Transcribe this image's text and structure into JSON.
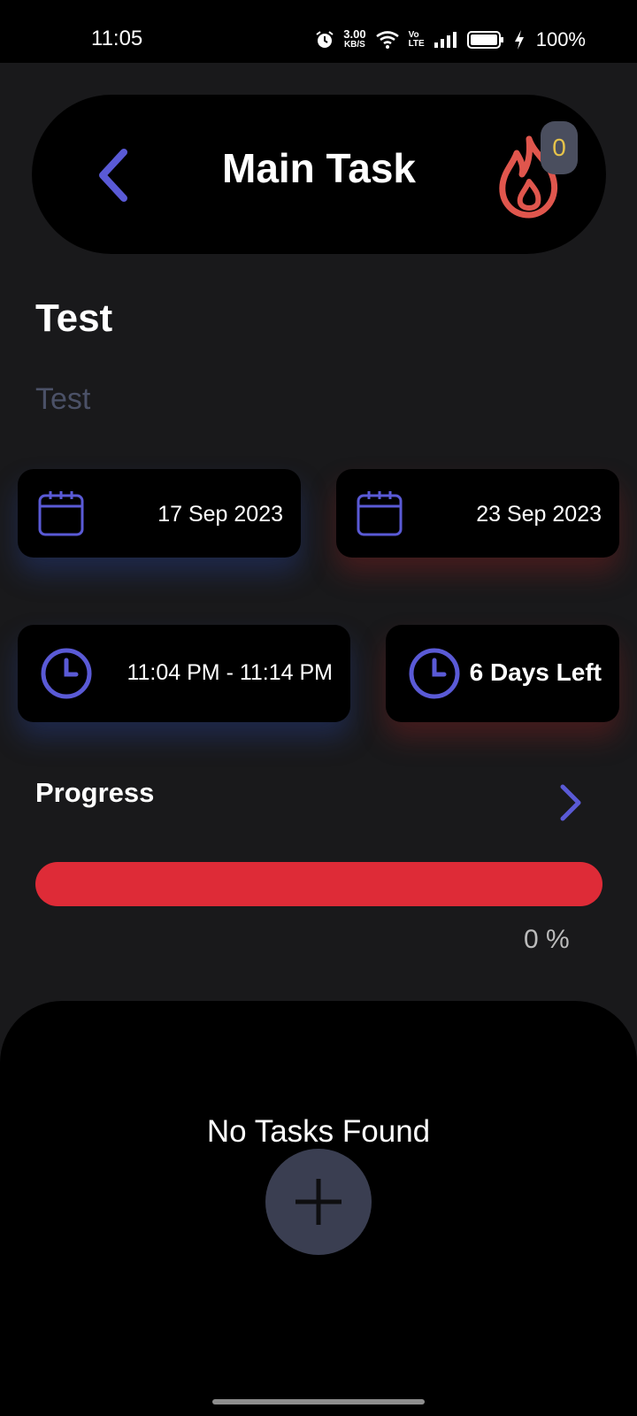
{
  "status_bar": {
    "time": "11:05",
    "net_speed": "3.00",
    "net_speed_unit": "KB/S",
    "volte_top": "Vo",
    "volte_bottom": "LTE",
    "battery": "100%"
  },
  "header": {
    "title": "Main Task",
    "streak_count": "0",
    "icons": [
      "back-arrow-icon",
      "fire-icon"
    ]
  },
  "task": {
    "title": "Test",
    "description": "Test"
  },
  "dates": {
    "start": "17 Sep 2023",
    "end": "23 Sep 2023"
  },
  "time": {
    "range": "11:04 PM - 11:14 PM",
    "days_left": "6 Days Left"
  },
  "progress": {
    "label": "Progress",
    "value": 0,
    "percent_text": "0 %"
  },
  "subtasks": {
    "empty_message": "No Tasks Found"
  },
  "colors": {
    "accent": "#5a5ad6",
    "fire": "#e0564d",
    "progress_track": "#de2b37",
    "badge_text": "#e6c34a"
  }
}
